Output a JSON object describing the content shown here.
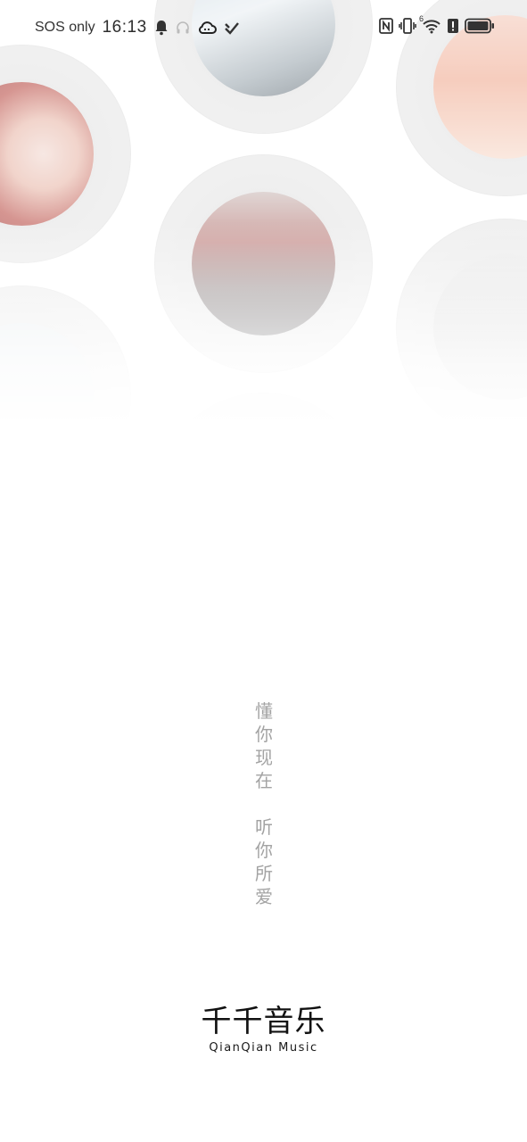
{
  "status_bar": {
    "carrier": "SOS only",
    "time": "16:13",
    "left_icons": [
      "bell-icon",
      "headphones-icon",
      "cloud-icon",
      "app-badge-icon"
    ],
    "right_icons": [
      "nfc-icon",
      "vibrate-icon",
      "wifi-icon",
      "alert-icon",
      "battery-icon"
    ],
    "wifi_label": "6"
  },
  "splash": {
    "slogan_line_1": [
      "懂",
      "你",
      "现",
      "在"
    ],
    "slogan_line_2": [
      "听",
      "你",
      "所",
      "爱"
    ],
    "logo_cn": "千千音乐",
    "logo_en": "QianQian Music"
  },
  "colors": {
    "background": "#ffffff",
    "slogan": "#a3a3a3",
    "logo": "#111111"
  }
}
